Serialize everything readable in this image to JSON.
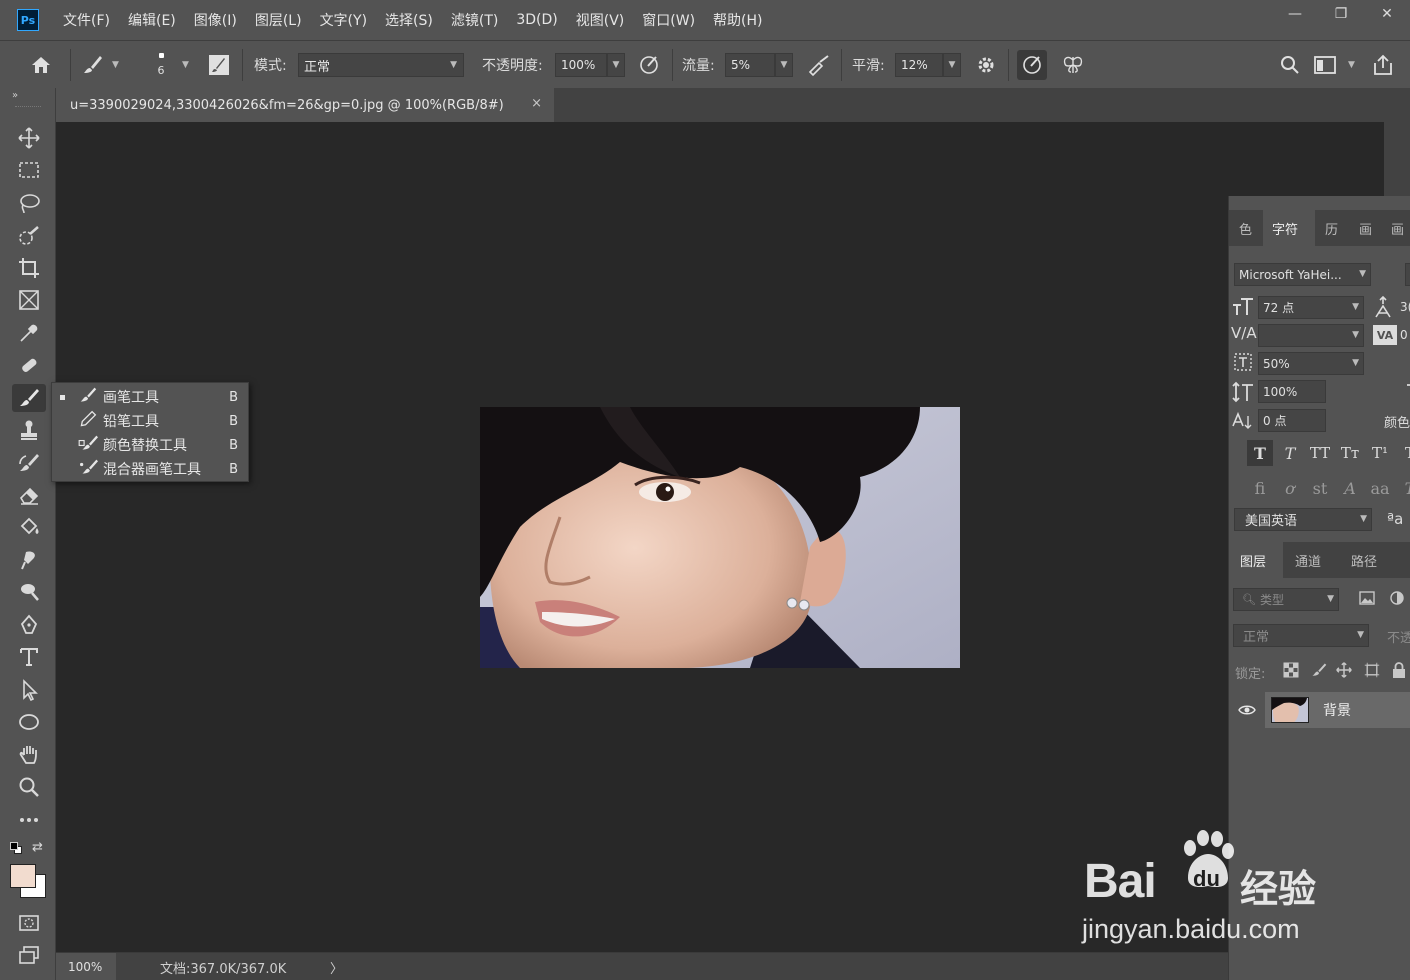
{
  "app": {
    "logo": "Ps"
  },
  "menu": [
    "文件(F)",
    "编辑(E)",
    "图像(I)",
    "图层(L)",
    "文字(Y)",
    "选择(S)",
    "滤镜(T)",
    "3D(D)",
    "视图(V)",
    "窗口(W)",
    "帮助(H)"
  ],
  "window_controls": {
    "minimize": "—",
    "restore": "❐",
    "close": "✕"
  },
  "options": {
    "brush_size": "6",
    "mode_label": "模式:",
    "mode_value": "正常",
    "opacity_label": "不透明度:",
    "opacity_value": "100%",
    "flow_label": "流量:",
    "flow_value": "5%",
    "smoothing_label": "平滑:",
    "smoothing_value": "12%"
  },
  "document": {
    "tab_title": "u=3390029024,3300426026&fm=26&gp=0.jpg @ 100%(RGB/8#)",
    "close": "×"
  },
  "status": {
    "zoom": "100%",
    "doc_info": "文档:367.0K/367.0K",
    "arrow": "〉"
  },
  "flyout": [
    {
      "label": "画笔工具",
      "key": "B",
      "icon": "brush-icon",
      "selected": true
    },
    {
      "label": "铅笔工具",
      "key": "B",
      "icon": "pencil-icon",
      "selected": false
    },
    {
      "label": "颜色替换工具",
      "key": "B",
      "icon": "color-replace-icon",
      "selected": false
    },
    {
      "label": "混合器画笔工具",
      "key": "B",
      "icon": "mixer-brush-icon",
      "selected": false
    }
  ],
  "character_panel": {
    "tabs": [
      "色",
      "字符",
      "历",
      "画",
      "画"
    ],
    "font_family": "Microsoft YaHei...",
    "font_size": "72 点",
    "leading_partial": "3(",
    "kerning": "",
    "tracking_partial": "0",
    "tsume": "50%",
    "vertical_scale": "100%",
    "baseline_shift": "0 点",
    "color_label_partial": "颜色",
    "language": "美国英语",
    "aa_label": "ªa"
  },
  "layers_panel": {
    "tabs": [
      "图层",
      "通道",
      "路径"
    ],
    "filter_placeholder": "类型",
    "blend_mode": "正常",
    "opacity_partial": "不透",
    "lock_label": "锁定:",
    "layer_name": "背景"
  },
  "colors": {
    "foreground": "#f2dccf",
    "background": "#ffffff",
    "ui_dark": "#535353",
    "canvas_bg": "#282828"
  },
  "watermark": {
    "brand": "Bai",
    "brand_suffix": "du",
    "cn": "经验",
    "url": "jingyan.baidu.com"
  }
}
